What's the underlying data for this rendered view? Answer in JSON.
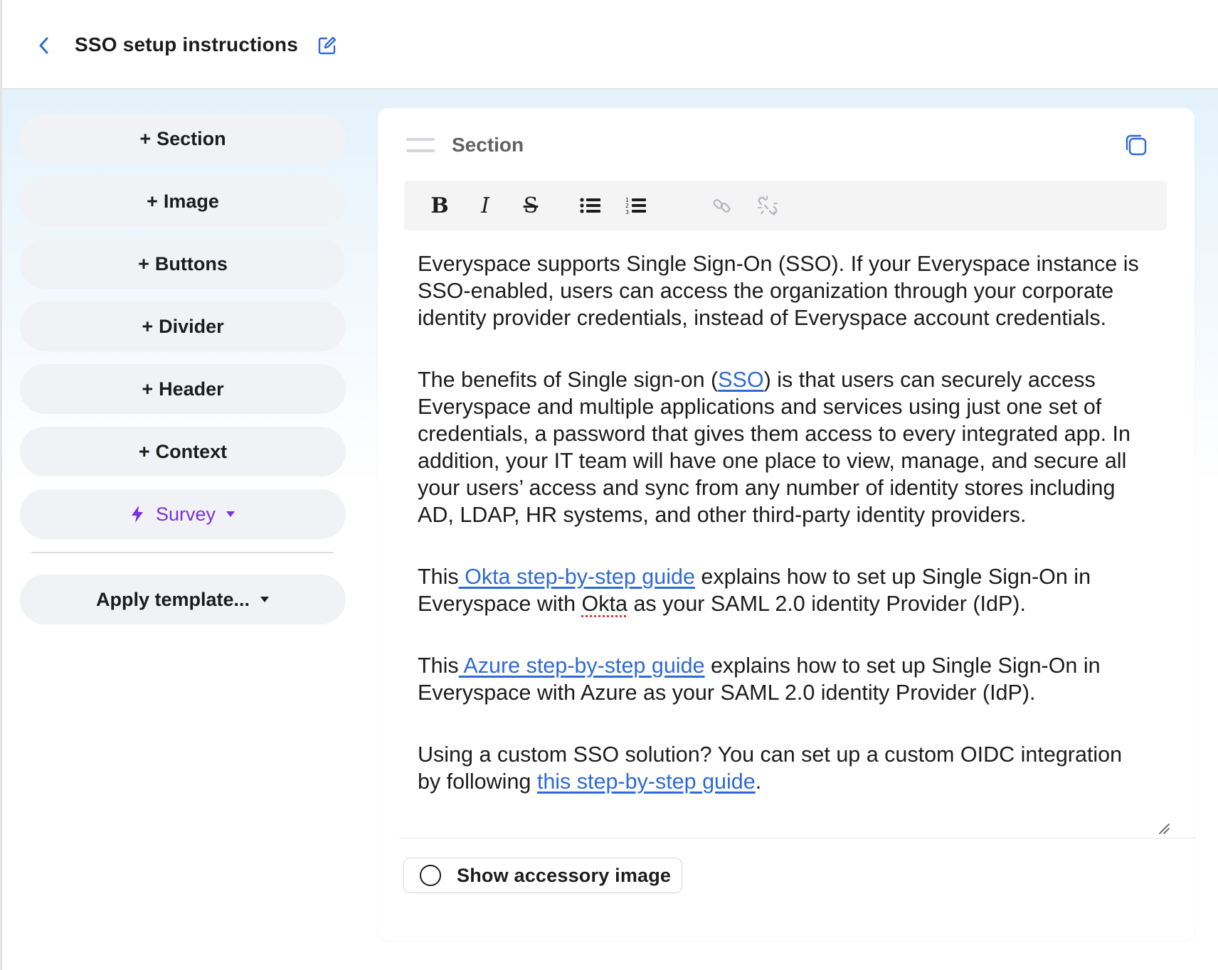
{
  "header": {
    "back_icon": "chevron-left-icon",
    "title": "SSO setup instructions",
    "edit_icon": "edit-icon"
  },
  "colors": {
    "accent": "#2e6ad6",
    "survey": "#7b2fe0",
    "pill_bg": "#f1f2f5",
    "text": "#1d1c1d"
  },
  "sidebar": {
    "blocks": [
      {
        "plus": "+",
        "label": "Section"
      },
      {
        "plus": "+",
        "label": "Image"
      },
      {
        "plus": "+",
        "label": "Buttons"
      },
      {
        "plus": "+",
        "label": "Divider"
      },
      {
        "plus": "+",
        "label": "Header"
      },
      {
        "plus": "+",
        "label": "Context"
      }
    ],
    "survey": {
      "label": "Survey",
      "icon": "bolt-icon",
      "caret": "caret-down-icon"
    },
    "template": {
      "label": "Apply template...",
      "caret": "caret-down-icon"
    }
  },
  "editor": {
    "block_type": "Section",
    "toolbar": {
      "bold": "B",
      "italic": "I",
      "strike": "S",
      "icons": [
        "bold-icon",
        "italic-icon",
        "strikethrough-icon",
        "bulleted-list-icon",
        "numbered-list-icon",
        "link-icon",
        "unlink-icon"
      ]
    },
    "paragraphs": {
      "p1": "Everyspace supports Single Sign-On (SSO). If your Everyspace instance is SSO-enabled, users can access the organization through your corporate identity provider credentials, instead of Everyspace account credentials.",
      "p2_before": "The benefits of Single sign-on (",
      "p2_link": "SSO",
      "p2_after": ") is that users can securely access Everyspace and multiple applications and services using just one set of credentials, a password that gives them access to every integrated app. In addition, your IT team will have one place to view, manage, and secure all your users’ access and sync from any number of identity stores including AD, LDAP, HR systems, and other third-party identity providers.",
      "p3_before": "This",
      "p3_link": " Okta step-by-step guide",
      "p3_mid": " explains how to set up Single Sign-On in Everyspace with ",
      "p3_okta": "Okta",
      "p3_after": " as your SAML 2.0 identity Provider (IdP).",
      "p4_before": "This",
      "p4_link": " Azure step-by-step guide",
      "p4_after": " explains how to set up Single Sign-On in Everyspace with Azure as your SAML 2.0 identity Provider (IdP).",
      "p5_before": "Using a custom SSO solution? You can set up a custom OIDC integration by following ",
      "p5_link": "this step-by-step guide",
      "p5_after": "."
    },
    "accessory_label": "Show accessory image"
  }
}
